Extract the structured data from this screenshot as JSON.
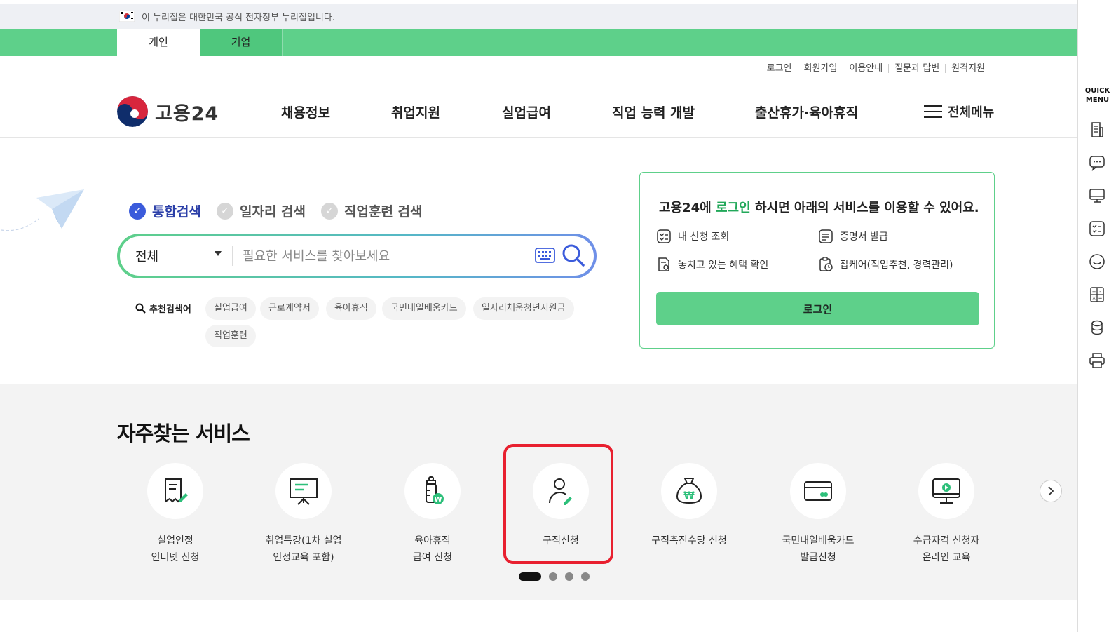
{
  "gov_banner": {
    "text": "이 누리집은 대한민국 공식 전자정부 누리집입니다."
  },
  "tabs": [
    {
      "label": "개인"
    },
    {
      "label": "기업"
    }
  ],
  "util_links": [
    "로그인",
    "회원가입",
    "이용안내",
    "질문과 답변",
    "원격지원"
  ],
  "logo": {
    "text": "고용24"
  },
  "nav": [
    "채용정보",
    "취업지원",
    "실업급여",
    "직업 능력 개발",
    "출산휴가·육아휴직"
  ],
  "all_menu_label": "전체메뉴",
  "search": {
    "types": [
      "통합검색",
      "일자리 검색",
      "직업훈련 검색"
    ],
    "selected_type": "통합검색",
    "scope": "전체",
    "placeholder": "필요한 서비스를 찾아보세요",
    "value": "",
    "recommended_label": "추천검색어",
    "recommended": [
      "실업급여",
      "근로계약서",
      "육아휴직",
      "국민내일배움카드",
      "일자리채움청년지원금",
      "직업훈련"
    ]
  },
  "login_box": {
    "title_prefix": "고용24에 ",
    "title_highlight": "로그인",
    "title_suffix": " 하시면 아래의 서비스를 이용할 수 있어요.",
    "items": [
      "내 신청 조회",
      "증명서 발급",
      "놓치고 있는 혜택 확인",
      "잡케어(직업추천, 경력관리)"
    ],
    "button": "로그인"
  },
  "services": {
    "title": "자주찾는 서비스",
    "items": [
      {
        "name": "실업인정\n인터넷 신청",
        "icon": "document-pen-icon"
      },
      {
        "name": "취업특강(1차 실업\n인정교육 포함)",
        "icon": "presentation-board-icon"
      },
      {
        "name": "육아휴직\n급여 신청",
        "icon": "baby-bottle-icon"
      },
      {
        "name": "구직신청",
        "icon": "person-pen-icon"
      },
      {
        "name": "구직촉진수당 신청",
        "icon": "money-bag-icon"
      },
      {
        "name": "국민내일배움카드\n발급신청",
        "icon": "card-icon"
      },
      {
        "name": "수급자격 신청자\n온라인 교육",
        "icon": "monitor-play-icon"
      }
    ],
    "highlighted_index": 3,
    "pages": 4,
    "current_page": 1
  },
  "quick_menu": {
    "title": "QUICK\nMENU",
    "icons": [
      "building-icon",
      "chat-icon",
      "monitor-icon",
      "checklist-icon",
      "smile-icon",
      "calculator-icon",
      "coin-icon",
      "printer-icon"
    ]
  },
  "colors": {
    "brand_green": "#5ed08a",
    "highlight_red": "#e8202f",
    "search_blue": "#3b5bdb"
  }
}
